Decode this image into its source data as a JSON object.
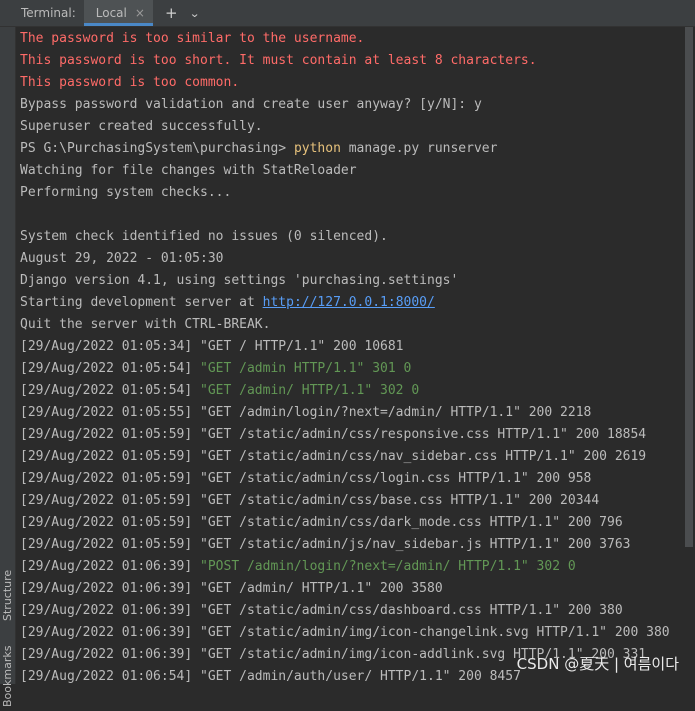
{
  "tabbar": {
    "label": "Terminal:",
    "tab_label": "Local",
    "close_icon": "×",
    "add_icon": "+",
    "chevron_icon": "⌄"
  },
  "sidebar": {
    "structure_label": "Structure",
    "bookmarks_label": "Bookmarks"
  },
  "console": {
    "lines": [
      {
        "text": "The password is too similar to the username.",
        "color": "red"
      },
      {
        "text": "This password is too short. It must contain at least 8 characters.",
        "color": "red"
      },
      {
        "text": "This password is too common.",
        "color": "red"
      },
      {
        "text": "Bypass password validation and create user anyway? [y/N]: y",
        "color": "default"
      },
      {
        "text": "Superuser created successfully.",
        "color": "default"
      },
      {
        "prompt": "PS G:\\PurchasingSystem\\purchasing> ",
        "command": "python",
        "rest": " manage.py runserver",
        "color": "default"
      },
      {
        "text": "Watching for file changes with StatReloader",
        "color": "default"
      },
      {
        "text": "Performing system checks...",
        "color": "default"
      },
      {
        "text": "",
        "color": "default"
      },
      {
        "text": "System check identified no issues (0 silenced).",
        "color": "default"
      },
      {
        "text": "August 29, 2022 - 01:05:30",
        "color": "default"
      },
      {
        "text": "Django version 4.1, using settings 'purchasing.settings'",
        "color": "default"
      },
      {
        "prefix": "Starting development server at ",
        "link": "http://127.0.0.1:8000/",
        "color": "default"
      },
      {
        "text": "Quit the server with CTRL-BREAK.",
        "color": "default"
      },
      {
        "time": "[29/Aug/2022 01:05:34] ",
        "msg": "\"GET / HTTP/1.1\" 200 10681",
        "color": "default"
      },
      {
        "time": "[29/Aug/2022 01:05:54] ",
        "msg": "\"GET /admin HTTP/1.1\" 301 0",
        "color": "green"
      },
      {
        "time": "[29/Aug/2022 01:05:54] ",
        "msg": "\"GET /admin/ HTTP/1.1\" 302 0",
        "color": "green"
      },
      {
        "time": "[29/Aug/2022 01:05:55] ",
        "msg": "\"GET /admin/login/?next=/admin/ HTTP/1.1\" 200 2218",
        "color": "default"
      },
      {
        "time": "[29/Aug/2022 01:05:59] ",
        "msg": "\"GET /static/admin/css/responsive.css HTTP/1.1\" 200 18854",
        "color": "default"
      },
      {
        "time": "[29/Aug/2022 01:05:59] ",
        "msg": "\"GET /static/admin/css/nav_sidebar.css HTTP/1.1\" 200 2619",
        "color": "default"
      },
      {
        "time": "[29/Aug/2022 01:05:59] ",
        "msg": "\"GET /static/admin/css/login.css HTTP/1.1\" 200 958",
        "color": "default"
      },
      {
        "time": "[29/Aug/2022 01:05:59] ",
        "msg": "\"GET /static/admin/css/base.css HTTP/1.1\" 200 20344",
        "color": "default"
      },
      {
        "time": "[29/Aug/2022 01:05:59] ",
        "msg": "\"GET /static/admin/css/dark_mode.css HTTP/1.1\" 200 796",
        "color": "default"
      },
      {
        "time": "[29/Aug/2022 01:05:59] ",
        "msg": "\"GET /static/admin/js/nav_sidebar.js HTTP/1.1\" 200 3763",
        "color": "default"
      },
      {
        "time": "[29/Aug/2022 01:06:39] ",
        "msg": "\"POST /admin/login/?next=/admin/ HTTP/1.1\" 302 0",
        "color": "green"
      },
      {
        "time": "[29/Aug/2022 01:06:39] ",
        "msg": "\"GET /admin/ HTTP/1.1\" 200 3580",
        "color": "default"
      },
      {
        "time": "[29/Aug/2022 01:06:39] ",
        "msg": "\"GET /static/admin/css/dashboard.css HTTP/1.1\" 200 380",
        "color": "default"
      },
      {
        "time": "[29/Aug/2022 01:06:39] ",
        "msg": "\"GET /static/admin/img/icon-changelink.svg HTTP/1.1\" 200 380",
        "color": "default"
      },
      {
        "time": "[29/Aug/2022 01:06:39] ",
        "msg": "\"GET /static/admin/img/icon-addlink.svg HTTP/1.1\" 200 331",
        "color": "default"
      },
      {
        "time": "[29/Aug/2022 01:06:54] ",
        "msg": "\"GET /admin/auth/user/ HTTP/1.1\" 200 8457",
        "color": "default"
      }
    ]
  },
  "watermark": "CSDN @夏天 | 여름이다",
  "colors": {
    "background": "#2b2b2b",
    "error_red": "#ff6b68",
    "redirect_green": "#629755",
    "link_blue": "#589df6",
    "command_yellow": "#e5c07b"
  }
}
